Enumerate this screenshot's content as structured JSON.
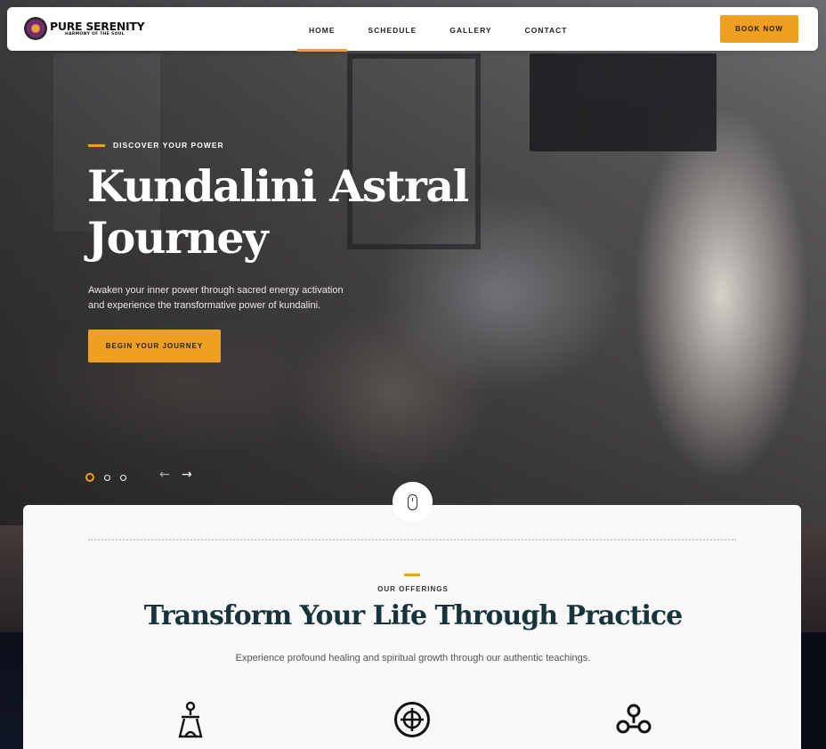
{
  "brand": {
    "name": "PURE SERENITY",
    "tagline": "HARMONY OF THE SOUL"
  },
  "nav": {
    "items": [
      {
        "label": "HOME",
        "active": true
      },
      {
        "label": "SCHEDULE",
        "active": false
      },
      {
        "label": "GALLERY",
        "active": false
      },
      {
        "label": "CONTACT",
        "active": false
      }
    ],
    "book_label": "BOOK NOW"
  },
  "hero": {
    "eyebrow": "DISCOVER YOUR POWER",
    "title_line1": "Kundalini Astral",
    "title_line2": "Journey",
    "description_line1": "Awaken your inner power through sacred energy activation",
    "description_line2": "and experience the transformative power of kundalini.",
    "cta_label": "BEGIN YOUR JOURNEY",
    "slider": {
      "total_slides": 3,
      "active_slide": 1,
      "prev_icon": "arrow-left-icon",
      "next_icon": "arrow-right-icon"
    }
  },
  "scroll_icon": "mouse-icon",
  "offerings": {
    "eyebrow": "OUR OFFERINGS",
    "title": "Transform Your Life Through Practice",
    "description": "Experience profound healing and spiritual growth through our authentic teachings.",
    "icons": [
      "meditation-figure-icon",
      "chakra-circle-icon",
      "energy-nodes-icon"
    ]
  },
  "colors": {
    "accent": "#f0a020",
    "heading": "#17343a",
    "card_bg": "#f8f8f8"
  }
}
